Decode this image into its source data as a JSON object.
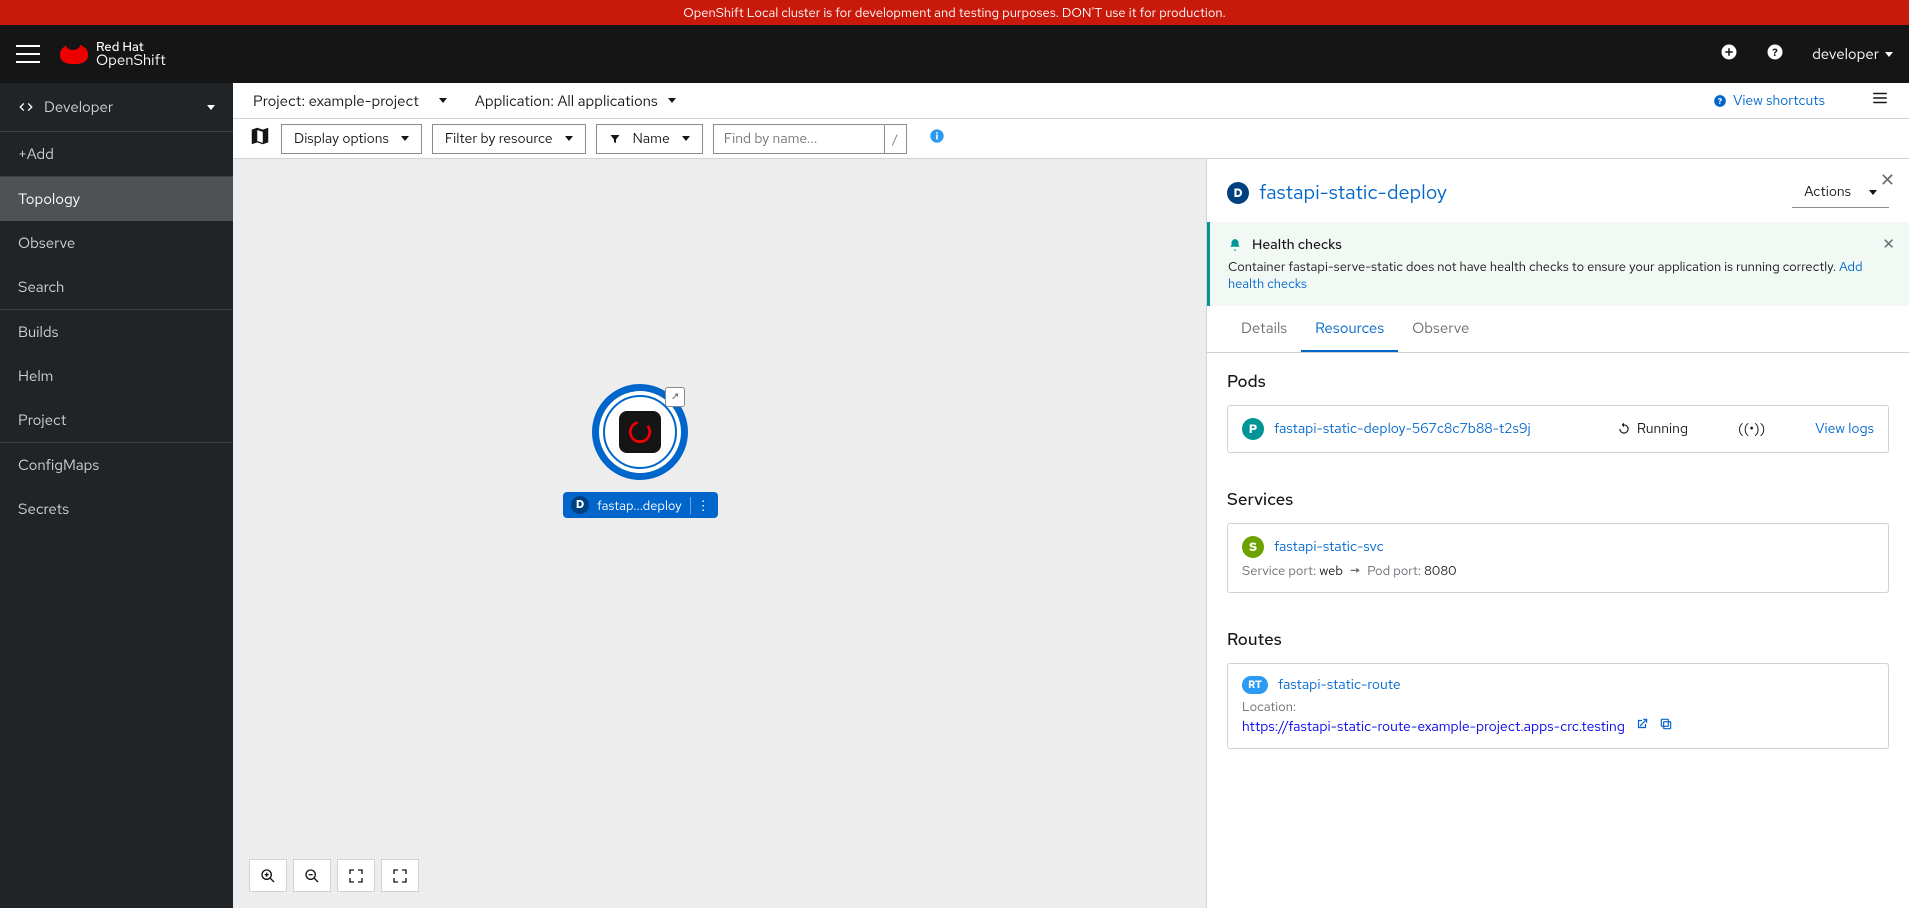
{
  "banner": "OpenShift Local cluster is for development and testing purposes. DON'T use it for production.",
  "brand": {
    "line1": "Red Hat",
    "line2": "OpenShift"
  },
  "user": "developer",
  "perspective": "Developer",
  "sidebar": {
    "items": [
      "+Add",
      "Topology",
      "Observe",
      "Search",
      "Builds",
      "Helm",
      "Project",
      "ConfigMaps",
      "Secrets"
    ],
    "active_index": 1
  },
  "project_bar": {
    "project_label": "Project: example-project",
    "app_label": "Application: All applications",
    "shortcuts": "View shortcuts"
  },
  "toolbar": {
    "display_options": "Display options",
    "filter_resource": "Filter by resource",
    "name_filter": "Name",
    "find_placeholder": "Find by name...",
    "key_hint": "/"
  },
  "topology_node": {
    "badge": "D",
    "label": "fastap...deploy"
  },
  "panel": {
    "badge": "D",
    "title": "fastapi-static-deploy",
    "actions": "Actions",
    "alert": {
      "title": "Health checks",
      "body_pre": "Container fastapi-serve-static does not have health checks to ensure your application is running correctly. ",
      "body_link": "Add health checks"
    },
    "tabs": [
      "Details",
      "Resources",
      "Observe"
    ],
    "active_tab": 1,
    "pods": {
      "heading": "Pods",
      "items": [
        {
          "badge": "P",
          "name": "fastapi-static-deploy-567c8c7b88-t2s9j",
          "status": "Running",
          "logs": "View logs"
        }
      ]
    },
    "services": {
      "heading": "Services",
      "items": [
        {
          "badge": "S",
          "name": "fastapi-static-svc",
          "port_label": "Service port:",
          "port_name": "web",
          "pod_port_label": "Pod port:",
          "pod_port": "8080"
        }
      ]
    },
    "routes": {
      "heading": "Routes",
      "items": [
        {
          "badge": "RT",
          "name": "fastapi-static-route",
          "loc_label": "Location:",
          "url": "https://fastapi-static-route-example-project.apps-crc.testing"
        }
      ]
    }
  }
}
